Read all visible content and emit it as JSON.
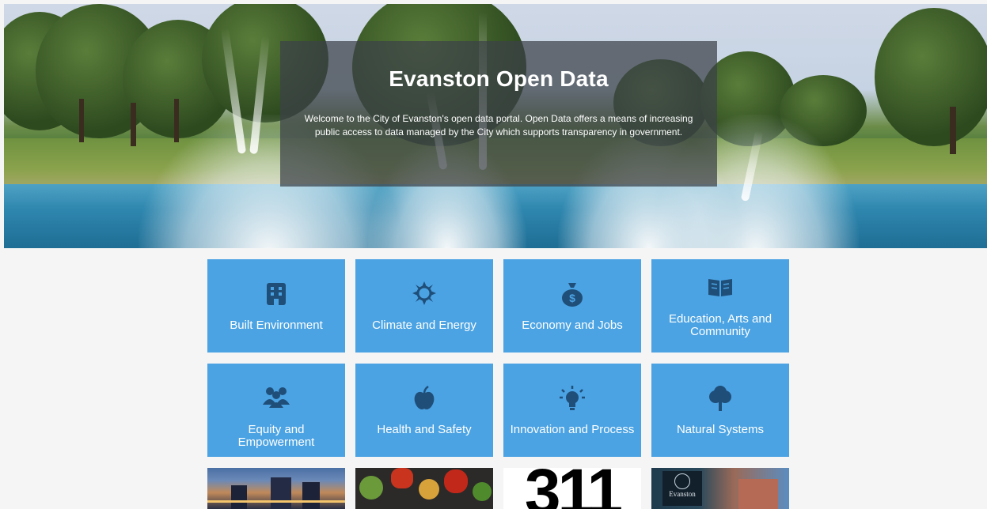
{
  "hero": {
    "title": "Evanston Open Data",
    "description": "Welcome to the City of Evanston's open data portal. Open Data offers a means of increasing public access to data managed by the City which supports transparency in government."
  },
  "categories": [
    {
      "label": "Built Environment",
      "icon": "building-icon"
    },
    {
      "label": "Climate and Energy",
      "icon": "sun-icon"
    },
    {
      "label": "Economy and Jobs",
      "icon": "money-bag-icon"
    },
    {
      "label": "Education, Arts and Community",
      "icon": "book-icon"
    },
    {
      "label": "Equity and Empowerment",
      "icon": "people-icon"
    },
    {
      "label": "Health and Safety",
      "icon": "apple-icon"
    },
    {
      "label": "Innovation and Process",
      "icon": "lightbulb-icon"
    },
    {
      "label": "Natural Systems",
      "icon": "tree-icon"
    }
  ],
  "thumbnails": [
    {
      "name": "city-skyline-thumbnail"
    },
    {
      "name": "vegetables-thumbnail"
    },
    {
      "name": "311-thumbnail",
      "text": "311"
    },
    {
      "name": "city-of-evanston-thumbnail",
      "text": "Evanston"
    }
  ],
  "colors": {
    "tile": "#4ba3e3",
    "icon": "#1f4e79",
    "overlay": "#3c4148"
  }
}
